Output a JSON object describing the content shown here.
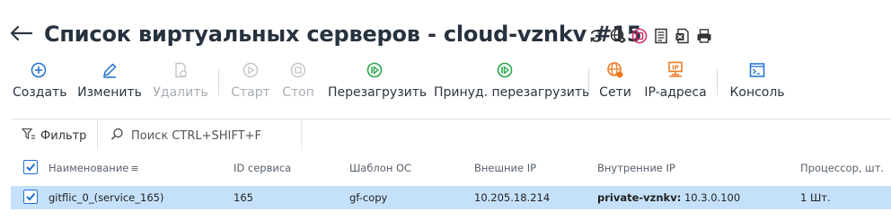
{
  "header": {
    "title": "Список виртуальных серверов - cloud-vznkv #15",
    "icons": [
      "refresh-icon",
      "globe-settings-icon",
      "power-icon",
      "document-list-icon",
      "excel-icon",
      "printer-icon"
    ]
  },
  "toolbar": {
    "create": "Создать",
    "edit": "Изменить",
    "delete": "Удалить",
    "start": "Старт",
    "stop": "Стоп",
    "restart": "Перезагрузить",
    "force_restart": "Принуд. перезагрузить",
    "networks": "Сети",
    "ip_addresses": "IP-адреса",
    "console": "Консоль"
  },
  "filterbar": {
    "filter_label": "Фильтр",
    "search_placeholder": "Поиск CTRL+SHIFT+F"
  },
  "table": {
    "columns": [
      "Наименование",
      "ID сервиса",
      "Шаблон ОС",
      "Внешние IP",
      "Внутренние IP",
      "Процессор, шт."
    ],
    "rows": [
      {
        "name": "gitflic_0_(service_165)",
        "service_id": "165",
        "template": "gf-copy",
        "external_ip": "10.205.18.214",
        "internal_ip_label": "private-vznkv:",
        "internal_ip": " 10.3.0.100",
        "cpu": "1 Шт."
      }
    ]
  },
  "colors": {
    "accent_blue": "#1e6fd1",
    "green": "#27a84a",
    "orange": "#ef7a22",
    "selected_row": "#c5e1fa"
  }
}
